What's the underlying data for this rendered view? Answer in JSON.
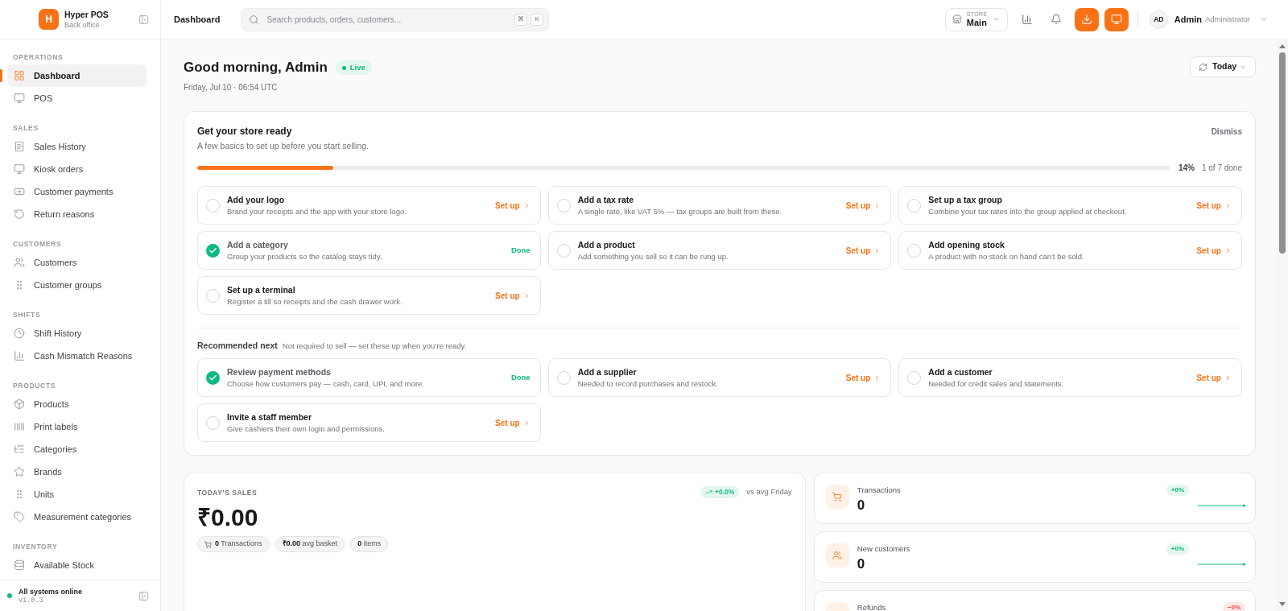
{
  "sidebar": {
    "brand": {
      "logo": "H",
      "name": "Hyper POS",
      "subtitle": "Back office"
    },
    "sections": [
      {
        "title": "OPERATIONS",
        "items": [
          {
            "label": "Dashboard",
            "selected": true
          },
          {
            "label": "POS",
            "selected": false
          }
        ]
      },
      {
        "title": "SALES",
        "items": [
          {
            "label": "Sales History",
            "selected": false
          },
          {
            "label": "Kiosk orders",
            "selected": false
          },
          {
            "label": "Customer payments",
            "selected": false
          },
          {
            "label": "Return reasons",
            "selected": false
          }
        ]
      },
      {
        "title": "CUSTOMERS",
        "items": [
          {
            "label": "Customers",
            "selected": false
          },
          {
            "label": "Customer groups",
            "selected": false
          }
        ]
      },
      {
        "title": "SHIFTS",
        "items": [
          {
            "label": "Shift History",
            "selected": false
          },
          {
            "label": "Cash Mismatch Reasons",
            "selected": false
          }
        ]
      },
      {
        "title": "PRODUCTS",
        "items": [
          {
            "label": "Products",
            "selected": false
          },
          {
            "label": "Print labels",
            "selected": false
          },
          {
            "label": "Categories",
            "selected": false
          },
          {
            "label": "Brands",
            "selected": false
          },
          {
            "label": "Units",
            "selected": false
          },
          {
            "label": "Measurement categories",
            "selected": false
          }
        ]
      },
      {
        "title": "INVENTORY",
        "items": [
          {
            "label": "Available Stock",
            "selected": false
          }
        ]
      }
    ],
    "footer": {
      "status": "All systems online",
      "version": "v1.0.3"
    }
  },
  "header": {
    "title": "Dashboard",
    "search": {
      "placeholder": "Search products, orders, customers...",
      "shortcut": [
        "⌘",
        "K"
      ]
    },
    "store": {
      "label": "STORE",
      "value": "Main"
    },
    "user": {
      "initials": "AD",
      "name": "Admin",
      "role": "Administrator"
    }
  },
  "greeting": {
    "title": "Good morning, Admin",
    "status": "Live",
    "date": "Friday, Jul 10 · 06:54 UTC",
    "range": "Today"
  },
  "setup": {
    "title": "Get your store ready",
    "subtitle": "A few basics to set up before you start selling.",
    "dismiss": "Dismiss",
    "progress": {
      "level": 0.14,
      "percent": "14%",
      "count": "1 of 7 done"
    },
    "tasks": [
      {
        "title": "Add your logo",
        "description": "Brand your receipts and the app with your store logo.",
        "status": "Set up",
        "done": false
      },
      {
        "title": "Add a tax rate",
        "description": "A single rate, like VAT 5% — tax groups are built from these.",
        "status": "Set up",
        "done": false
      },
      {
        "title": "Set up a tax group",
        "description": "Combine your tax rates into the group applied at checkout.",
        "status": "Set up",
        "done": false
      },
      {
        "title": "Add a category",
        "description": "Group your products so the catalog stays tidy.",
        "status": "Done",
        "done": true
      },
      {
        "title": "Add a product",
        "description": "Add something you sell so it can be rung up.",
        "status": "Set up",
        "done": false
      },
      {
        "title": "Add opening stock",
        "description": "A product with no stock on hand can’t be sold.",
        "status": "Set up",
        "done": false
      },
      {
        "title": "Set up a terminal",
        "description": "Register a till so receipts and the cash drawer work.",
        "status": "Set up",
        "done": false
      }
    ],
    "recommended": {
      "title": "Recommended next",
      "note": "Not required to sell — set these up when you’re ready.",
      "tasks": [
        {
          "title": "Review payment methods",
          "description": "Choose how customers pay — cash, card, UPI, and more.",
          "status": "Done",
          "done": true
        },
        {
          "title": "Add a supplier",
          "description": "Needed to record purchases and restock.",
          "status": "Set up",
          "done": false
        },
        {
          "title": "Add a customer",
          "description": "Needed for credit sales and statements.",
          "status": "Set up",
          "done": false
        },
        {
          "title": "Invite a staff member",
          "description": "Give cashiers their own login and permissions.",
          "status": "Set up",
          "done": false
        }
      ]
    }
  },
  "sales": {
    "title": "TODAY’S SALES",
    "change": "+0.0%",
    "comparison": "vs avg Friday",
    "amount": "₹0.00",
    "pills": [
      {
        "value": "0",
        "label": "Transactions"
      },
      {
        "value": "₹0.00",
        "label": "avg basket"
      },
      {
        "value": "0",
        "label": "items"
      }
    ]
  },
  "stats": [
    {
      "label": "Transactions",
      "value": "0",
      "change": "+0%",
      "negative": false
    },
    {
      "label": "New customers",
      "value": "0",
      "change": "+0%",
      "negative": false
    },
    {
      "label": "Refunds",
      "change": "−0%",
      "negative": true
    }
  ]
}
